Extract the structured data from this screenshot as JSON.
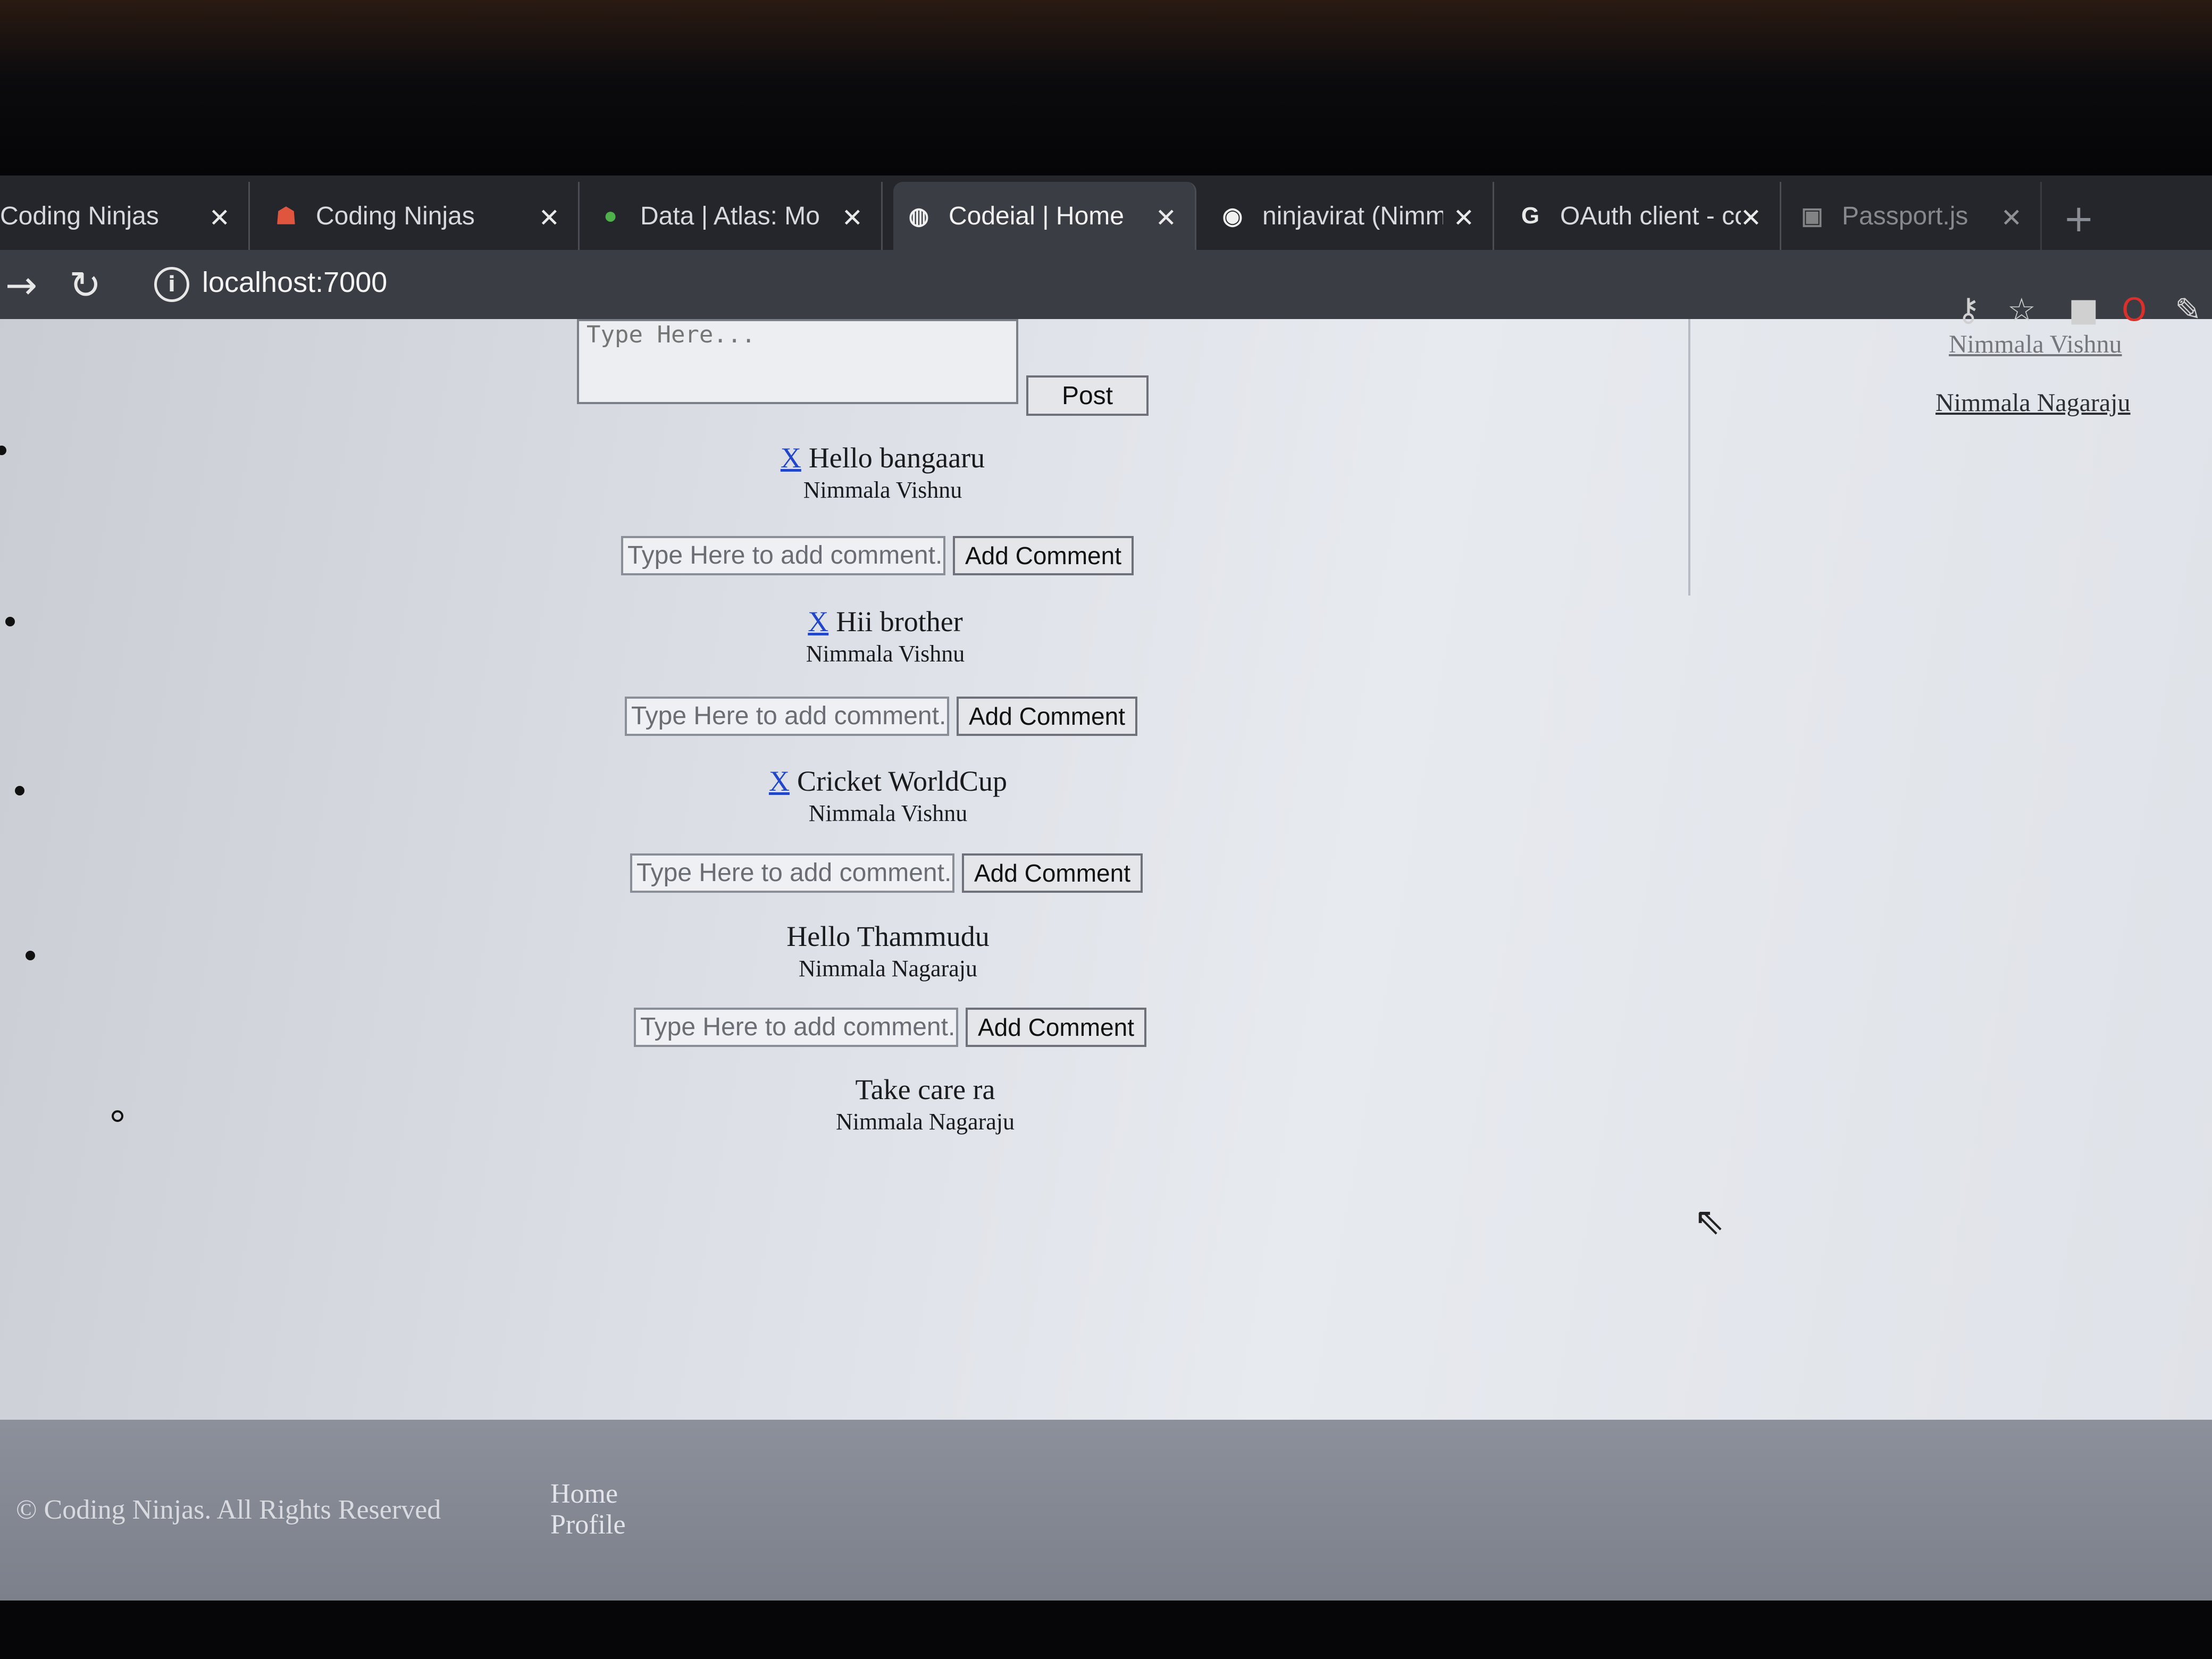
{
  "browser": {
    "tabs": [
      {
        "title": "Coding Ninjas",
        "favicon": "none"
      },
      {
        "title": "Coding Ninjas",
        "favicon": "coding-ninjas-icon"
      },
      {
        "title": "Data | Atlas: Mong",
        "favicon": "mongodb-leaf-icon"
      },
      {
        "title": "Codeial | Home",
        "favicon": "globe-icon",
        "active": true
      },
      {
        "title": "ninjavirat (Nimma",
        "favicon": "github-icon"
      },
      {
        "title": "OAuth client - coc",
        "favicon": "google-icon"
      },
      {
        "title": "Passport.js",
        "favicon": "passport-icon"
      }
    ],
    "close_glyph": "✕",
    "new_tab_glyph": "+",
    "url": "localhost:7000"
  },
  "post_form": {
    "placeholder": "Type Here...",
    "submit_label": "Post"
  },
  "friends": [
    "Nimmala Vishnu",
    "Nimmala Nagaraju"
  ],
  "posts": [
    {
      "delete_label": "X",
      "content": "Hello bangaaru",
      "author": "Nimmala Vishnu"
    },
    {
      "delete_label": "X",
      "content": "Hii brother",
      "author": "Nimmala Vishnu"
    },
    {
      "delete_label": "X",
      "content": "Cricket WorldCup",
      "author": "Nimmala Vishnu"
    },
    {
      "content": "Hello Thammudu",
      "author": "Nimmala Nagaraju"
    },
    {
      "content": "Take care ra",
      "author": "Nimmala Nagaraju"
    }
  ],
  "comment_form": {
    "placeholder": "Type Here to add comment..",
    "submit_label": "Add Comment"
  },
  "footer": {
    "copyright": "© Coding Ninjas. All Rights Reserved",
    "links": [
      "Home",
      "Profile"
    ]
  }
}
